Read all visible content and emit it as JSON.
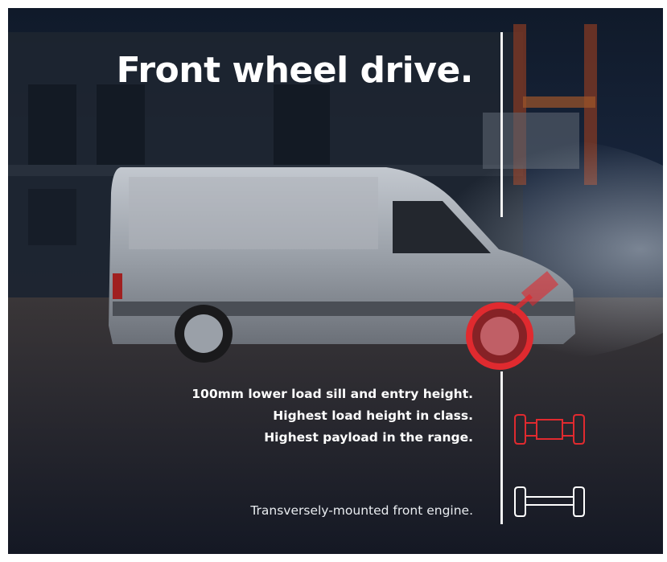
{
  "headline": "Front wheel drive.",
  "features": [
    "100mm lower load sill and entry height.",
    "Highest load height in class.",
    "Highest payload in the range."
  ],
  "engine_note": "Transversely-mounted front engine.",
  "icons": {
    "drive_axle": "front-drive-axle-icon",
    "engine_axle": "axle-layout-icon"
  },
  "colors": {
    "accent_red": "#e02a2f",
    "text": "#ffffff",
    "divider": "#f2f2f2"
  }
}
